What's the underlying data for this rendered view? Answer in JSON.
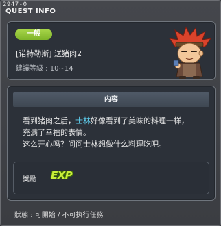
{
  "header": {
    "quest_id": "2947-0",
    "title": "QUEST INFO"
  },
  "quest": {
    "category": "一般",
    "name": "[诺特勒斯] 送猪肉2",
    "level_requirement": "建議等級 : 10~14"
  },
  "content": {
    "header": "内容",
    "description_part1": "看到猪肉之后，",
    "highlight_npc": "士林",
    "description_part2": "好像看到了美味的料理一样，",
    "description_line2": "充满了幸福的表情。",
    "description_line3": "这么开心吗？问问士林想做什么料理吃吧。"
  },
  "reward": {
    "label": "獎勵",
    "icon_text": "EXP",
    "icon": "exp-icon"
  },
  "status": "狀態 : 可開始 / 不可执行任務",
  "colors": {
    "badge": "#8cc63f",
    "highlight": "#5fd0f0",
    "panel": "#2c3139"
  }
}
